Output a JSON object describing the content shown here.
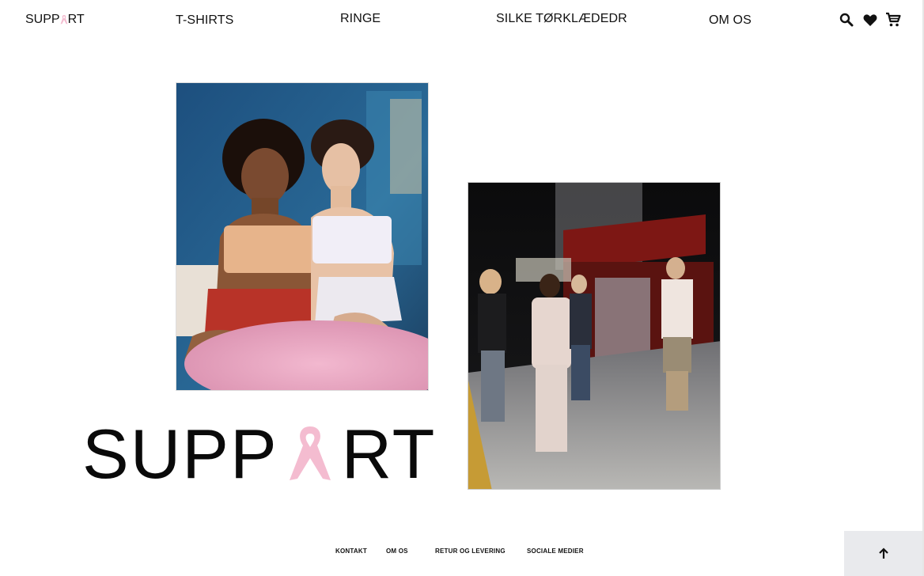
{
  "header": {
    "logo_left": "SUPP",
    "logo_right": "RT",
    "nav": {
      "tshirts": "T-SHIRTS",
      "ringe": "RINGE",
      "silke": "SILKE TØRKLÆDEDR",
      "om_os": "OM OS"
    },
    "icons": [
      "search-icon",
      "heart-icon",
      "cart-icon"
    ]
  },
  "hero": {
    "logo_left": "SUPP",
    "logo_right": "RT"
  },
  "footer": {
    "kontakt": "KONTAKT",
    "om_os": "OM OS",
    "retur": "RETUR OG LEVERING",
    "sociale": "SOCIALE MEDIER"
  },
  "colors": {
    "ribbon": "#f4bcd0",
    "to_top_bg": "#e9eaed"
  }
}
